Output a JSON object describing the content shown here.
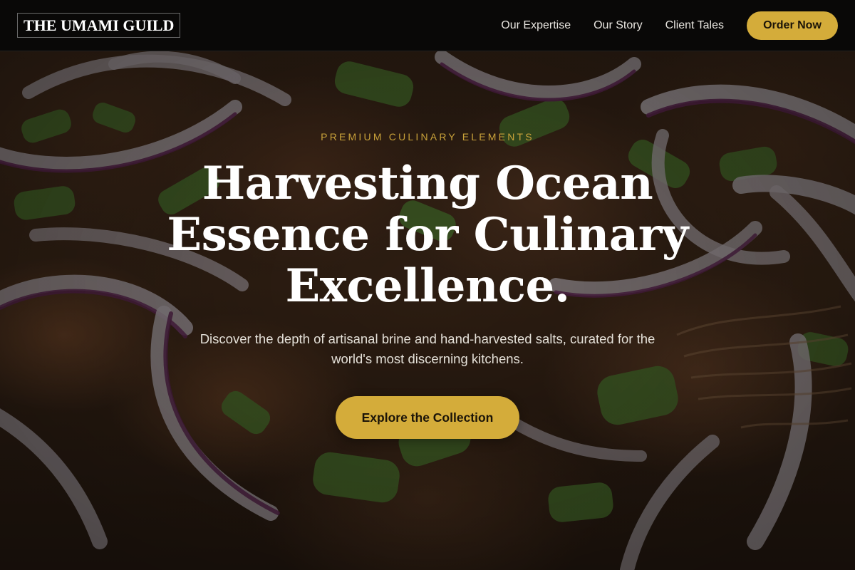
{
  "header": {
    "logo_text": "THE UMAMI GUILD",
    "nav": [
      {
        "label": "Our Expertise"
      },
      {
        "label": "Our Story"
      },
      {
        "label": "Client Tales"
      }
    ],
    "order_button_label": "Order Now"
  },
  "hero": {
    "eyebrow": "PREMIUM CULINARY ELEMENTS",
    "headline": "Harvesting Ocean Essence for Culinary Excellence.",
    "subheadline": "Discover the depth of artisanal brine and hand-harvested salts, curated for the world's most discerning kitchens.",
    "cta_label": "Explore the Collection",
    "background_image": "red-onion-and-scallion-dish-photo"
  },
  "colors": {
    "accent": "#d4ac3a",
    "eyebrow": "#c9a23a",
    "header_bg": "#080808",
    "text_light": "#ffffff"
  }
}
